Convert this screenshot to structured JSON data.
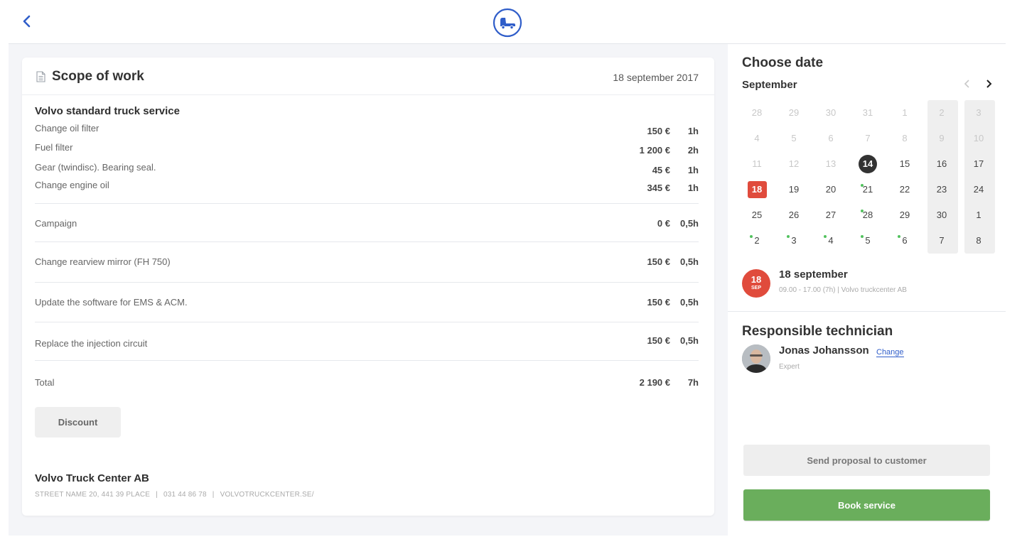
{
  "header": {
    "back_icon": "chevron-left-icon",
    "logo_icon": "truck-icon",
    "brand_color": "#2f5dc9"
  },
  "scope": {
    "title": "Scope of work",
    "date": "18 september 2017",
    "group_title": "Volvo standard truck service",
    "items": [
      {
        "name": "Change oil filter",
        "price": "150 €",
        "hours": "1h"
      },
      {
        "name": "Fuel filter",
        "price": "1 200 €",
        "hours": "2h"
      },
      {
        "name": "Gear (twindisc). Bearing seal.",
        "price": "45 €",
        "hours": "1h"
      },
      {
        "name": "Change engine oil",
        "price": "345 €",
        "hours": "1h"
      }
    ],
    "rows": [
      {
        "name": "Campaign",
        "price": "0 €",
        "hours": "0,5h"
      },
      {
        "name": "Change rearview mirror  (FH 750)",
        "price": "150 €",
        "hours": "0,5h"
      },
      {
        "name": "Update the software for EMS & ACM.",
        "price": "150 €",
        "hours": "0,5h"
      },
      {
        "name": "Replace the injection circuit",
        "price": "150 €",
        "hours": "0,5h"
      },
      {
        "name": "Total",
        "price": "2 190 €",
        "hours": "7h"
      }
    ],
    "discount_label": "Discount"
  },
  "company": {
    "name": "Volvo Truck Center AB",
    "address": "STREET NAME 20, 441 39 PLACE",
    "phone": "031 44 86 78",
    "website": "VOLVOTRUCKCENTER.SE/"
  },
  "calendar": {
    "heading": "Choose date",
    "month": "September",
    "prev_icon": "chevron-left-icon",
    "next_icon": "chevron-right-icon",
    "weeks": [
      [
        {
          "d": "28",
          "m": true
        },
        {
          "d": "29",
          "m": true
        },
        {
          "d": "30",
          "m": true
        },
        {
          "d": "31",
          "m": true
        },
        {
          "d": "1",
          "m": true
        },
        {
          "d": "2",
          "m": true
        },
        {
          "d": "3",
          "m": true
        }
      ],
      [
        {
          "d": "4",
          "m": true
        },
        {
          "d": "5",
          "m": true
        },
        {
          "d": "6",
          "m": true
        },
        {
          "d": "7",
          "m": true
        },
        {
          "d": "8",
          "m": true
        },
        {
          "d": "9",
          "m": true
        },
        {
          "d": "10",
          "m": true
        }
      ],
      [
        {
          "d": "11",
          "m": true
        },
        {
          "d": "12",
          "m": true
        },
        {
          "d": "13",
          "m": true
        },
        {
          "d": "14",
          "today": true
        },
        {
          "d": "15"
        },
        {
          "d": "16"
        },
        {
          "d": "17"
        }
      ],
      [
        {
          "d": "18",
          "selected": true
        },
        {
          "d": "19"
        },
        {
          "d": "20"
        },
        {
          "d": "21",
          "dot": true
        },
        {
          "d": "22"
        },
        {
          "d": "23"
        },
        {
          "d": "24"
        }
      ],
      [
        {
          "d": "25"
        },
        {
          "d": "26"
        },
        {
          "d": "27"
        },
        {
          "d": "28",
          "dot": true
        },
        {
          "d": "29"
        },
        {
          "d": "30"
        },
        {
          "d": "1"
        }
      ],
      [
        {
          "d": "2",
          "dot": true
        },
        {
          "d": "3",
          "dot": true
        },
        {
          "d": "4",
          "dot": true
        },
        {
          "d": "5",
          "dot": true
        },
        {
          "d": "6",
          "dot": true
        },
        {
          "d": "7"
        },
        {
          "d": "8"
        }
      ]
    ],
    "selected_color": "#e04b3c",
    "available_color": "#52c25e"
  },
  "selected": {
    "day": "18",
    "month_abbr": "SEP",
    "title": "18 september",
    "details": "09.00 - 17.00 (7h)  |  Volvo truckcenter  AB"
  },
  "technician": {
    "heading": "Responsible technician",
    "name": "Jonas Johansson",
    "change_label": "Change",
    "role": "Expert"
  },
  "actions": {
    "send_label": "Send proposal to customer",
    "book_label": "Book service",
    "book_color": "#6aae5c"
  }
}
